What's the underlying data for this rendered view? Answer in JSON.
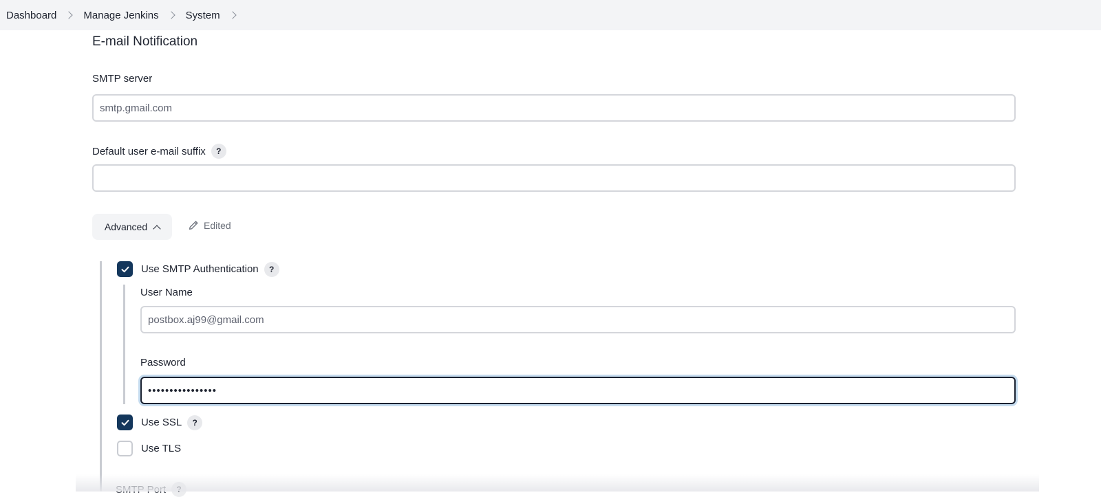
{
  "breadcrumb": {
    "items": [
      "Dashboard",
      "Manage Jenkins",
      "System"
    ]
  },
  "section": {
    "title": "E-mail Notification"
  },
  "smtp_server": {
    "label": "SMTP server",
    "value": "smtp.gmail.com"
  },
  "default_suffix": {
    "label": "Default user e-mail suffix",
    "help": "?",
    "value": ""
  },
  "advanced": {
    "label": "Advanced",
    "edited_label": "Edited"
  },
  "smtp_auth": {
    "label": "Use SMTP Authentication",
    "help": "?",
    "checked": true,
    "username_label": "User Name",
    "username_value": "postbox.aj99@gmail.com",
    "password_label": "Password",
    "password_value": "••••••••••••••••"
  },
  "use_ssl": {
    "label": "Use SSL",
    "help": "?",
    "checked": true
  },
  "use_tls": {
    "label": "Use TLS",
    "checked": false
  },
  "smtp_port": {
    "label": "SMTP Port",
    "help": "?"
  },
  "colors": {
    "breadcrumb_bg": "#f3f4f6",
    "checkbox_checked": "#14375c",
    "focus_ring": "#c6dcef",
    "text": "#1f2430"
  }
}
